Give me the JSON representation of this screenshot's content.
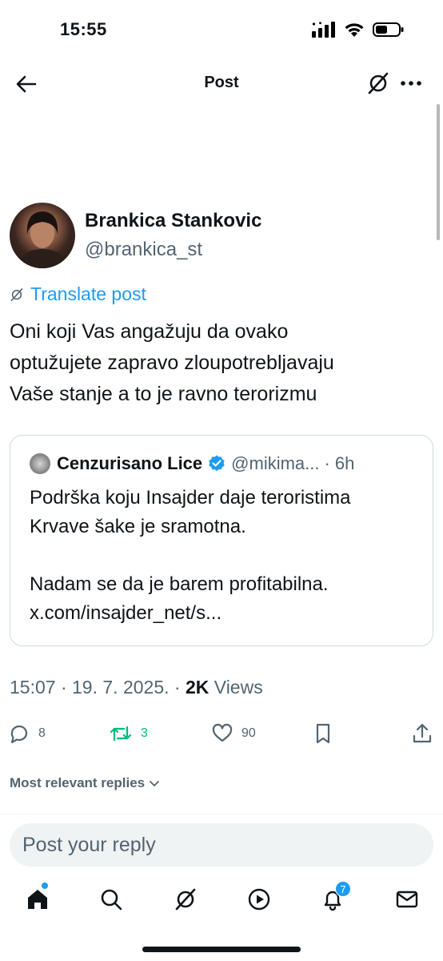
{
  "status_bar": {
    "time": "15:55"
  },
  "nav": {
    "title": "Post"
  },
  "author": {
    "name": "Brankica Stankovic",
    "handle": "@brankica_st"
  },
  "translate_label": "Translate post",
  "post": {
    "text_lines": [
      "Oni koji Vas angažuju da ovako",
      "optužujete zapravo zloupotrebljavaju",
      "Vaše stanje a to je ravno terorizmu"
    ]
  },
  "quote": {
    "name": "Cenzurisano Lice",
    "handle": "@mikima...",
    "separator": "·",
    "time": "6h",
    "text": "Podrška koju Insajder daje teroristima\nKrvave šake je sramotna.\n\nNadam se da je barem profitabilna.\nx.com/insajder_net/s..."
  },
  "meta": {
    "time": "15:07",
    "sep1": "·",
    "date": "19. 7. 2025.",
    "sep2": "·",
    "views_count": "2K",
    "views_label": "Views"
  },
  "actions": {
    "replies": "8",
    "reposts": "3",
    "likes": "90"
  },
  "replies_sort": {
    "label": "Most relevant replies"
  },
  "reply_box": {
    "placeholder": "Post your reply"
  },
  "tabs": {
    "notifications_badge": "7"
  },
  "colors": {
    "accent": "#1d9bf0",
    "repost_green": "#00ba7c",
    "text": "#0f1419",
    "secondary": "#536471"
  }
}
